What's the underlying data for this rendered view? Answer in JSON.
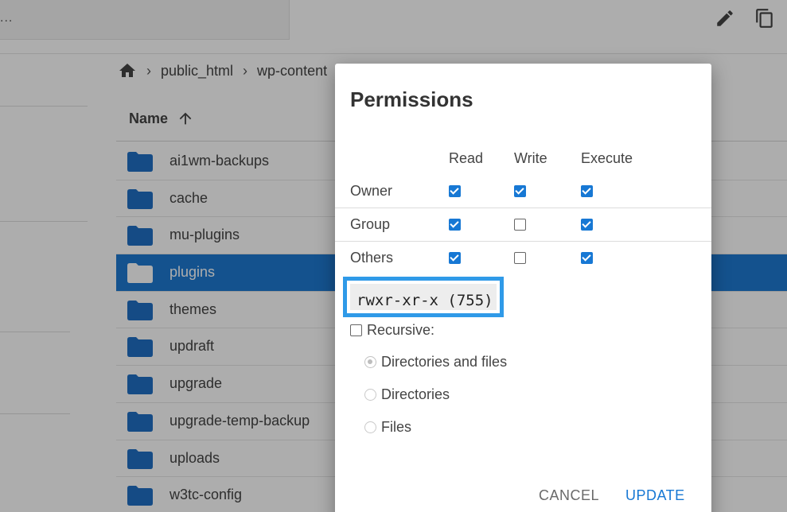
{
  "topbar": {
    "search_text": "...",
    "edit_icon": "pencil-icon",
    "copy_icon": "copy-icon"
  },
  "breadcrumb": {
    "home_icon": "home-icon",
    "items": [
      "public_html",
      "wp-content"
    ]
  },
  "table": {
    "column_name": "Name",
    "sort_icon": "arrow-up-icon",
    "rows": [
      {
        "name": "ai1wm-backups",
        "selected": false
      },
      {
        "name": "cache",
        "selected": false
      },
      {
        "name": "mu-plugins",
        "selected": false
      },
      {
        "name": "plugins",
        "selected": true
      },
      {
        "name": "themes",
        "selected": false
      },
      {
        "name": "updraft",
        "selected": false
      },
      {
        "name": "upgrade",
        "selected": false
      },
      {
        "name": "upgrade-temp-backup",
        "selected": false
      },
      {
        "name": "uploads",
        "selected": false
      },
      {
        "name": "w3tc-config",
        "selected": false
      }
    ]
  },
  "dialog": {
    "title": "Permissions",
    "columns": [
      "Read",
      "Write",
      "Execute"
    ],
    "rows": [
      {
        "label": "Owner",
        "read": true,
        "write": true,
        "execute": true
      },
      {
        "label": "Group",
        "read": true,
        "write": false,
        "execute": true
      },
      {
        "label": "Others",
        "read": true,
        "write": false,
        "execute": true
      }
    ],
    "mode_string": "rwxr-xr-x (755)",
    "recursive_label": "Recursive:",
    "recursive_checked": false,
    "recursive_options": [
      {
        "label": "Directories and files",
        "checked": true
      },
      {
        "label": "Directories",
        "checked": false
      },
      {
        "label": "Files",
        "checked": false
      }
    ],
    "cancel_label": "CANCEL",
    "update_label": "UPDATE"
  },
  "colors": {
    "accent": "#1778d4",
    "selected_row": "#1e7ad1",
    "folder": "#1f6fc5",
    "highlight_border": "#2f9ae8"
  }
}
